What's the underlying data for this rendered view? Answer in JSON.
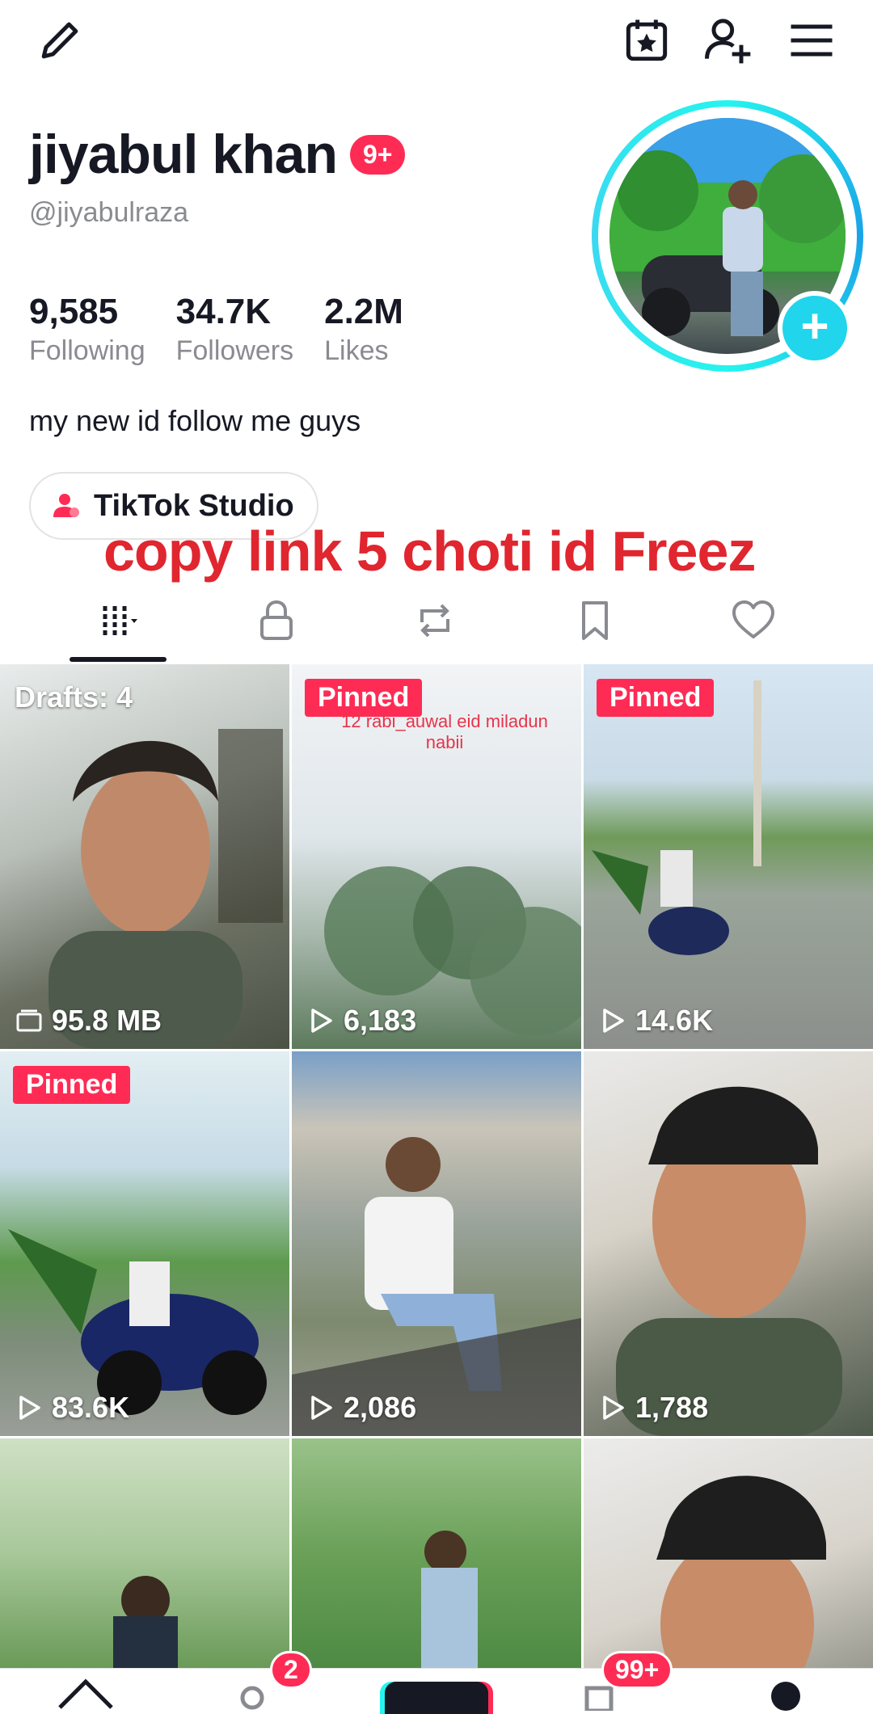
{
  "profile": {
    "display_name": "jiyabul khan",
    "notification_badge": "9+",
    "username": "@jiyabulraza",
    "bio": "my new id follow me guys"
  },
  "stats": [
    {
      "value": "9,585",
      "label": "Following"
    },
    {
      "value": "34.7K",
      "label": "Followers"
    },
    {
      "value": "2.2M",
      "label": "Likes"
    }
  ],
  "studio_button": {
    "label": "TikTok Studio"
  },
  "overlay_text": "copy link 5 choti id Freez",
  "tiles": [
    {
      "drafts": "Drafts: 4",
      "stat": "95.8 MB"
    },
    {
      "badge": "Pinned",
      "caption": "12 rabi_auwal eid miladun nabii",
      "stat": "6,183"
    },
    {
      "badge": "Pinned",
      "stat": "14.6K"
    },
    {
      "badge": "Pinned",
      "stat": "83.6K"
    },
    {
      "stat": "2,086"
    },
    {
      "stat": "1,788"
    },
    {},
    {},
    {}
  ],
  "bottom_nav": {
    "friends_badge": "2",
    "inbox_badge": "99+"
  },
  "colors": {
    "accent": "#fe2c55",
    "avatar_ring": "#25f4ee",
    "overlay_text": "#e0262f"
  }
}
